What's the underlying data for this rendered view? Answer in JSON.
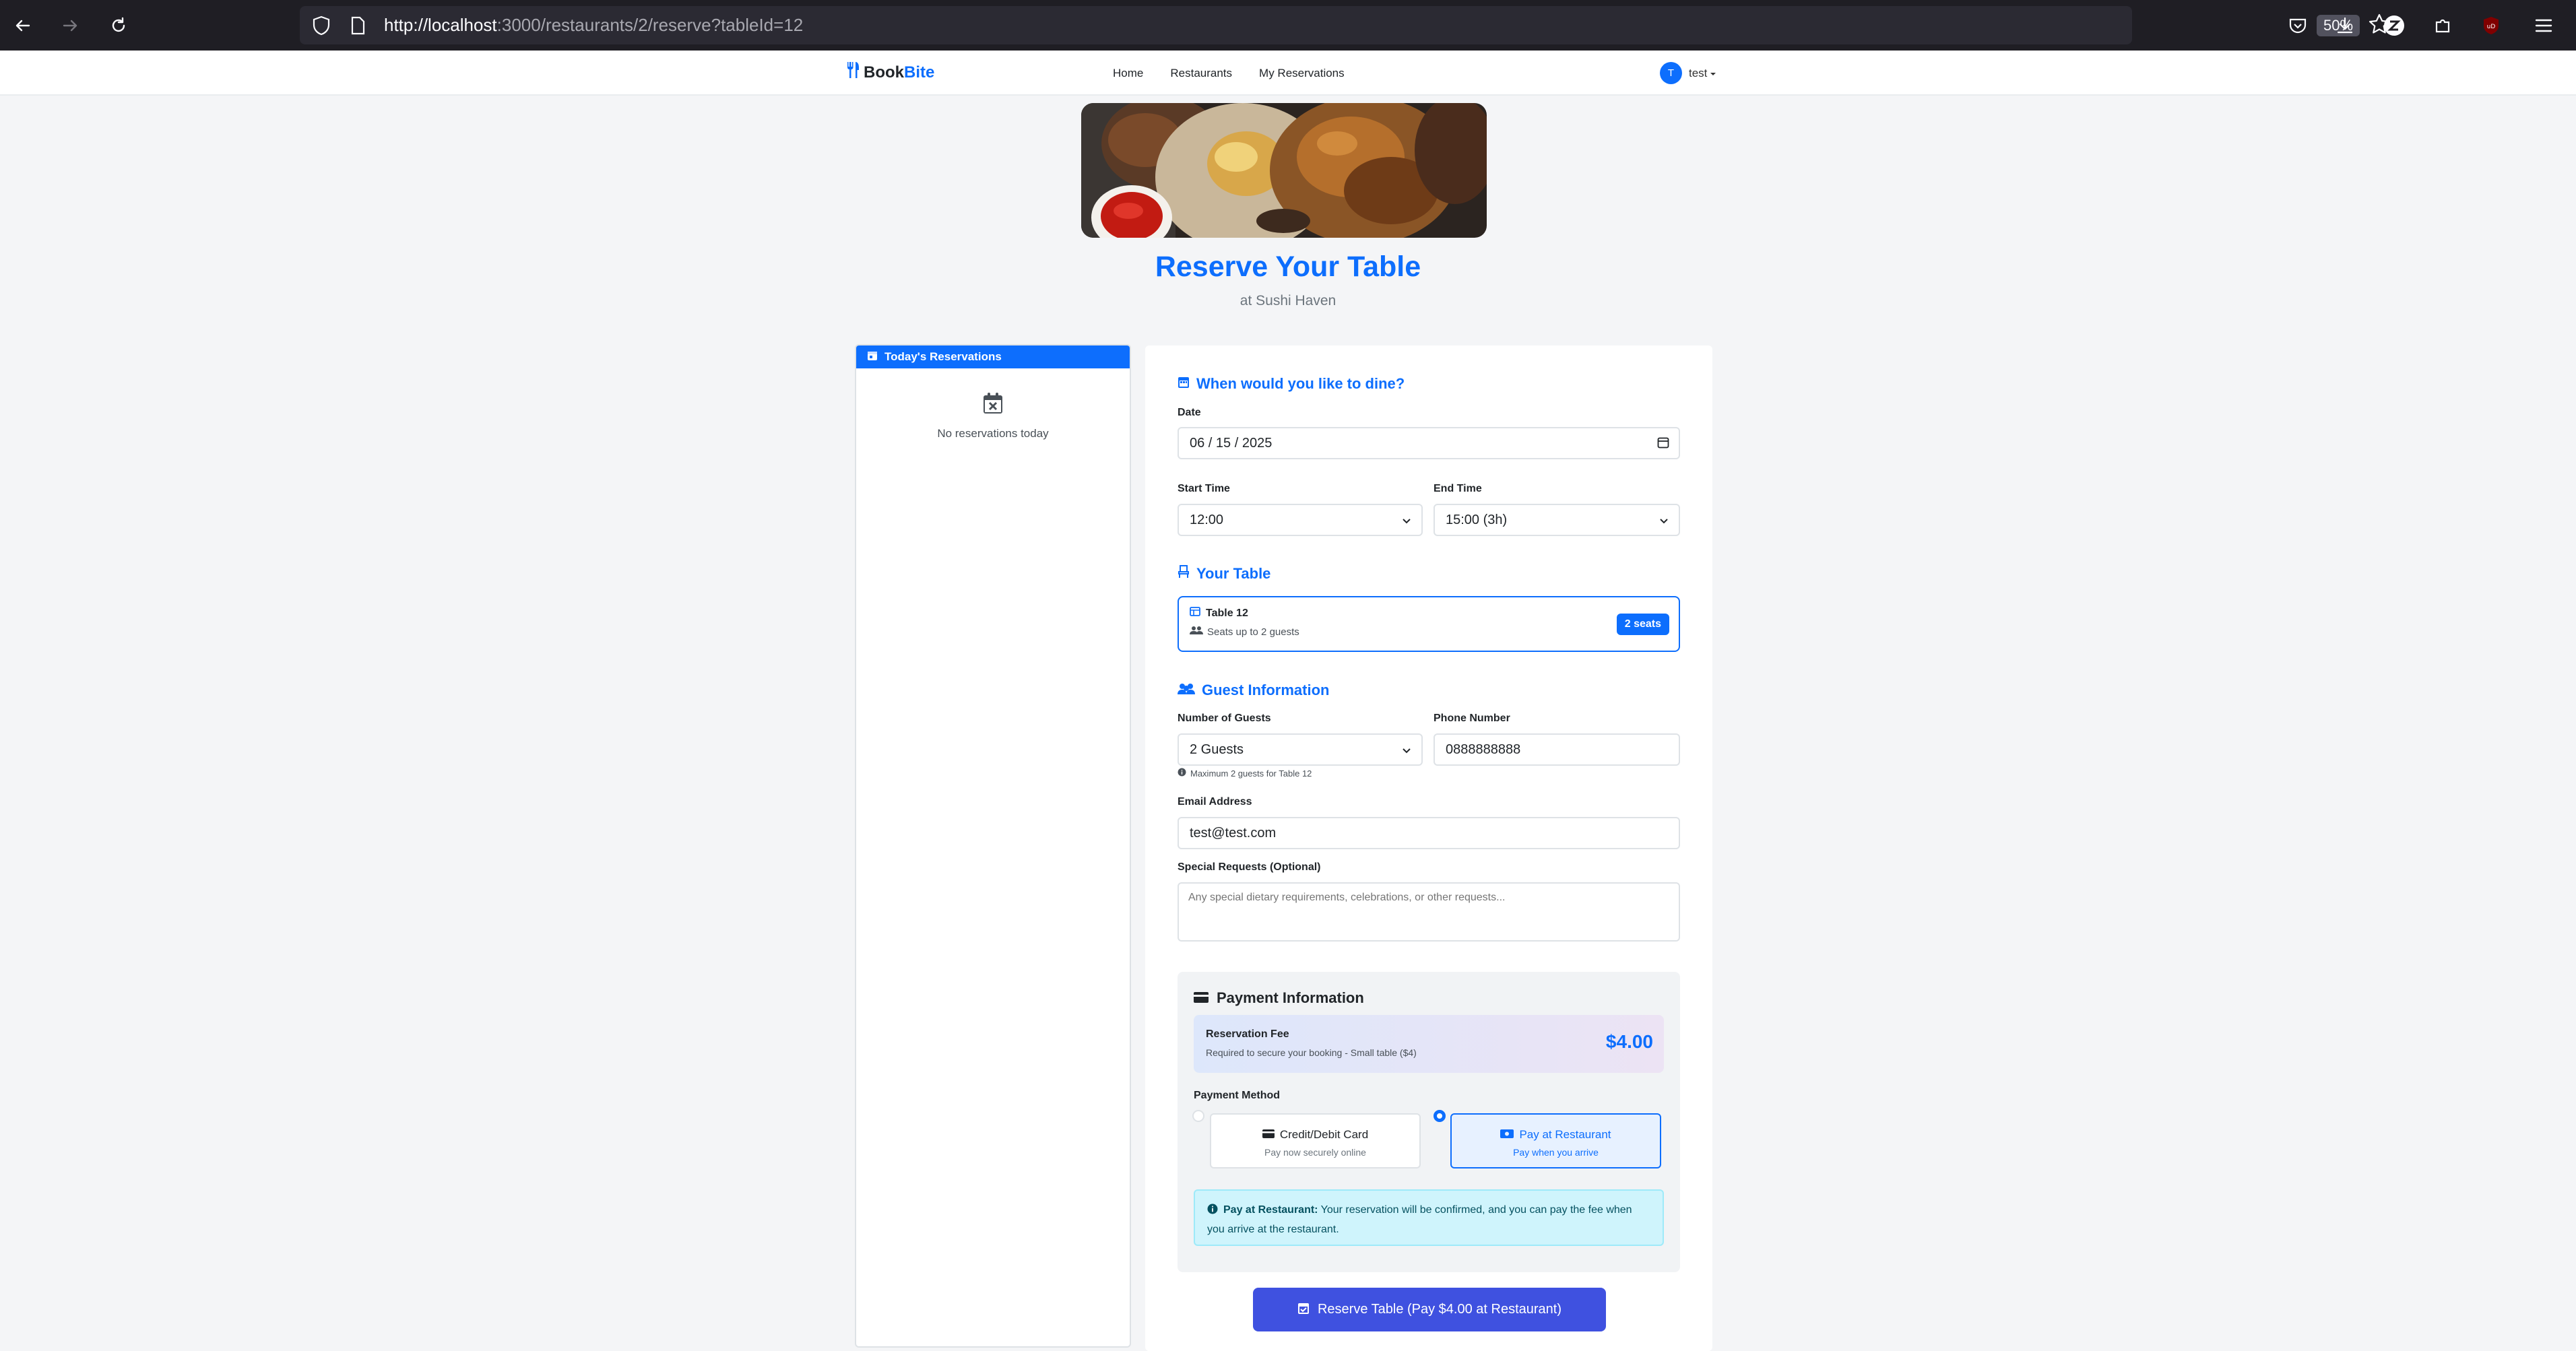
{
  "browser": {
    "url_host": "http://localhost",
    "url_rest": ":3000/restaurants/2/reserve?tableId=12",
    "zoom": "50%"
  },
  "nav": {
    "brand_part1": "Book",
    "brand_part2": "Bite",
    "links": [
      "Home",
      "Restaurants",
      "My Reservations"
    ],
    "user_initial": "T",
    "user_name": "test"
  },
  "header": {
    "title": "Reserve Your Table",
    "subtitle": "at Sushi Haven"
  },
  "left_panel": {
    "title": "Today's Reservations",
    "empty_text": "No reservations today"
  },
  "form": {
    "when": {
      "title": "When would you like to dine?",
      "date_label": "Date",
      "date_value": "06 / 15 / 2025",
      "start_label": "Start Time",
      "start_value": "12:00",
      "end_label": "End Time",
      "end_value": "15:00 (3h)"
    },
    "table": {
      "title": "Your Table",
      "name": "Table 12",
      "capacity": "Seats up to 2 guests",
      "badge": "2 seats"
    },
    "guest": {
      "title": "Guest Information",
      "guests_label": "Number of Guests",
      "guests_value": "2 Guests",
      "phone_label": "Phone Number",
      "phone_value": "0888888888",
      "hint": "Maximum 2 guests for Table 12",
      "email_label": "Email Address",
      "email_value": "test@test.com",
      "requests_label": "Special Requests (Optional)",
      "requests_placeholder": "Any special dietary requirements, celebrations, or other requests..."
    },
    "payment": {
      "title": "Payment Information",
      "fee_label": "Reservation Fee",
      "fee_desc": "Required to secure your booking - Small table ($4)",
      "fee_amount": "$4.00",
      "method_label": "Payment Method",
      "card_title": "Credit/Debit Card",
      "card_sub": "Pay now securely online",
      "rest_title": "Pay at Restaurant",
      "rest_sub": "Pay when you arrive",
      "info_bold": "Pay at Restaurant:",
      "info_text": " Your reservation will be confirmed, and you can pay the fee when you arrive at the restaurant."
    },
    "submit_label": "Reserve Table (Pay $4.00 at Restaurant)"
  },
  "colors": {
    "primary": "#0d6efd",
    "submit": "#3f51e0",
    "info_bg": "#cff4fc"
  }
}
